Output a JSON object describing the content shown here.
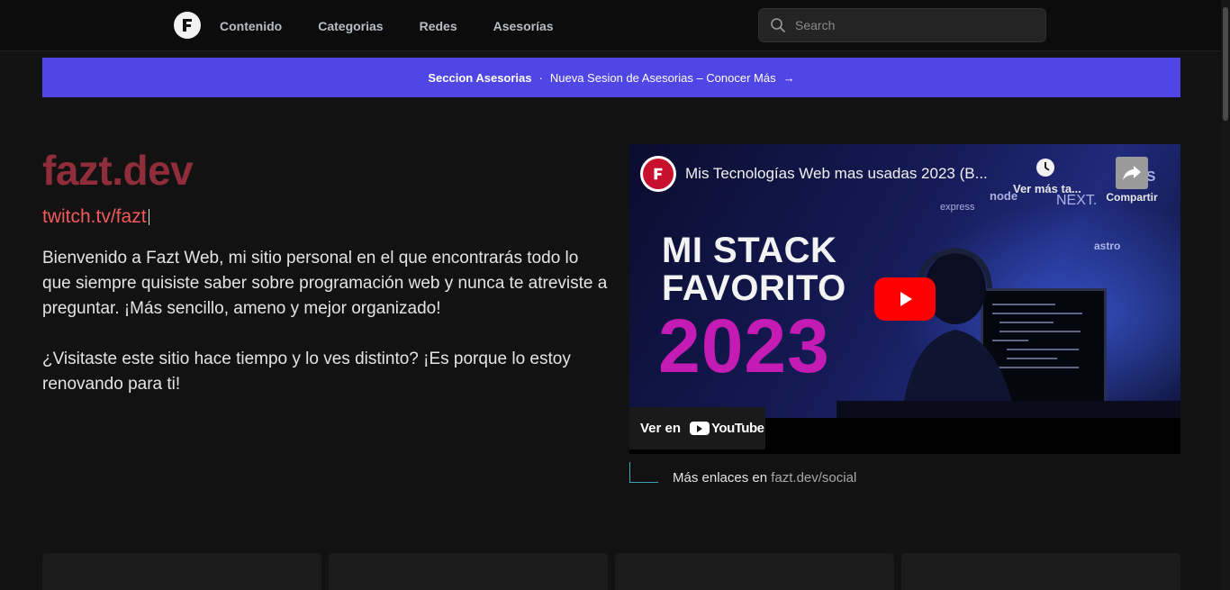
{
  "nav": {
    "links": [
      "Contenido",
      "Categorias",
      "Redes",
      "Asesorías"
    ],
    "search_placeholder": "Search"
  },
  "banner": {
    "section": "Seccion Asesorias",
    "separator": "·",
    "text": "Nueva Sesion de Asesorias – Conocer Más",
    "arrow": "→"
  },
  "hero": {
    "title": "fazt.dev",
    "twitch": "twitch.tv/fazt",
    "paragraphs": [
      "Bienvenido a Fazt Web, mi sitio personal en el que encontrarás todo lo que siempre quisiste saber sobre programación web y nunca te atreviste a preguntar. ¡Más sencillo, ameno y mejor organizado!",
      "¿Visitaste este sitio hace tiempo y lo ves distinto? ¡Es porque lo estoy renovando para ti!"
    ]
  },
  "video": {
    "title": "Mis Tecnologías Web mas usadas 2023 (B...",
    "watch_later": "Ver más ta...",
    "share": "Compartir",
    "headline_line1": "MI STACK",
    "headline_line2": "FAVORITO",
    "year": "2023",
    "watch_on": "Ver en",
    "youtube": "YouTube",
    "tech_labels": [
      "express",
      "node",
      "NEXT.",
      "astro",
      "TS"
    ]
  },
  "links": {
    "prefix": "Más enlaces en",
    "link": "fazt.dev/social"
  },
  "colors": {
    "banner": "#4f46e5",
    "brand": "#8f2d3a",
    "twitch": "#f25a5a",
    "year": "#c31bb3"
  }
}
